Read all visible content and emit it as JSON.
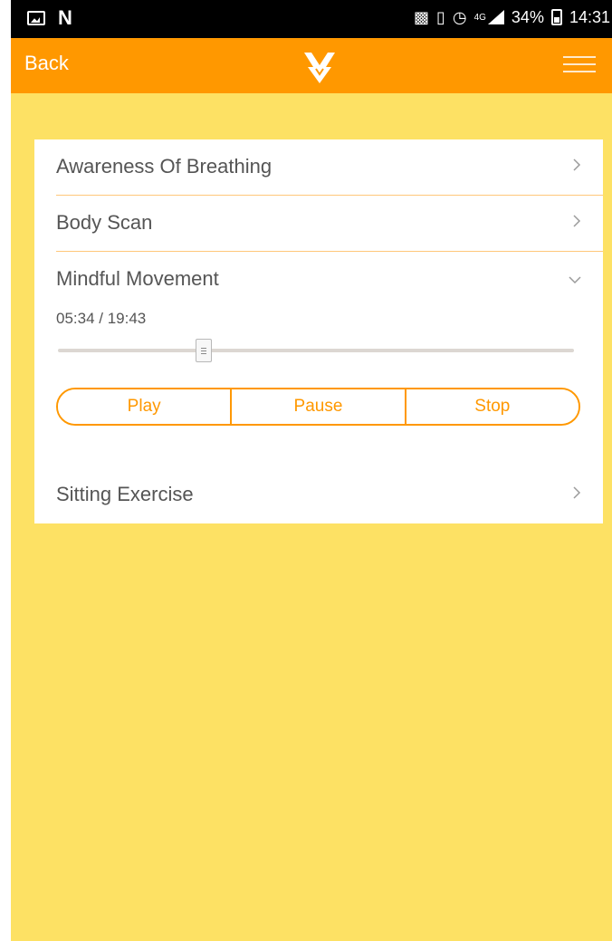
{
  "status_bar": {
    "left_icons": [
      "image-icon",
      "n-icon"
    ],
    "right_icons": [
      "nfc-icon",
      "vibrate-icon",
      "alarm-icon",
      "signal-icon",
      "battery-icon"
    ],
    "network": "4G",
    "battery_percent": "34%",
    "time": "14:31"
  },
  "header": {
    "back_label": "Back",
    "logo_icon": "app-logo-icon",
    "menu_icon": "menu-icon",
    "color": "#FF9800"
  },
  "colors": {
    "background": "#FDE164",
    "accent": "#FF9800",
    "divider": "#FFC77A",
    "text": "#555555"
  },
  "exercises": [
    {
      "label": "Awareness Of Breathing",
      "state": "collapsed",
      "icon": "chevron-right-icon"
    },
    {
      "label": "Body Scan",
      "state": "collapsed",
      "icon": "chevron-right-icon"
    },
    {
      "label": "Mindful Movement",
      "state": "expanded",
      "icon": "chevron-down-icon"
    },
    {
      "label": "Sitting Exercise",
      "state": "collapsed",
      "icon": "chevron-right-icon"
    }
  ],
  "player": {
    "elapsed": "05:34",
    "duration": "19:43",
    "time_text": "05:34 / 19:43",
    "progress": 0.2825,
    "buttons": {
      "play": "Play",
      "pause": "Pause",
      "stop": "Stop"
    }
  }
}
